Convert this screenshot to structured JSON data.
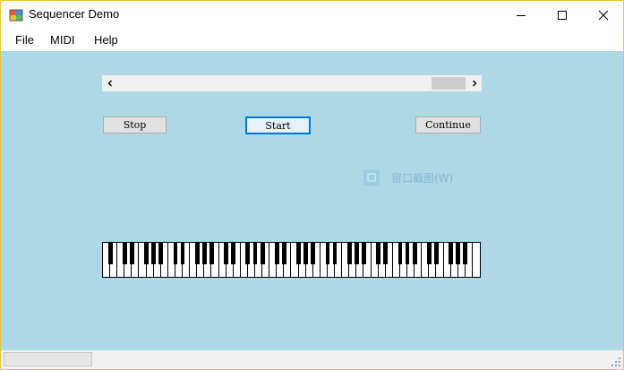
{
  "window": {
    "title": "Sequencer Demo",
    "controls": {
      "minimize": "minimize",
      "maximize": "maximize",
      "close": "close"
    }
  },
  "menu": {
    "items": [
      {
        "label": "File"
      },
      {
        "label": "MIDI"
      },
      {
        "label": "Help"
      }
    ]
  },
  "scrollbar": {
    "left_icon": "chevron-left-icon",
    "right_icon": "chevron-right-icon",
    "position": 0.93
  },
  "buttons": {
    "stop": "Stop",
    "start": "Start",
    "continue": "Continue"
  },
  "overlay": {
    "text": "窗口截图(W)",
    "icon": "capture-icon"
  },
  "piano": {
    "white_keys": 52,
    "has_black_keys": true
  },
  "colors": {
    "client_bg": "#add8e6",
    "focus_border": "#0078d7",
    "window_border": "#f0c43a"
  }
}
